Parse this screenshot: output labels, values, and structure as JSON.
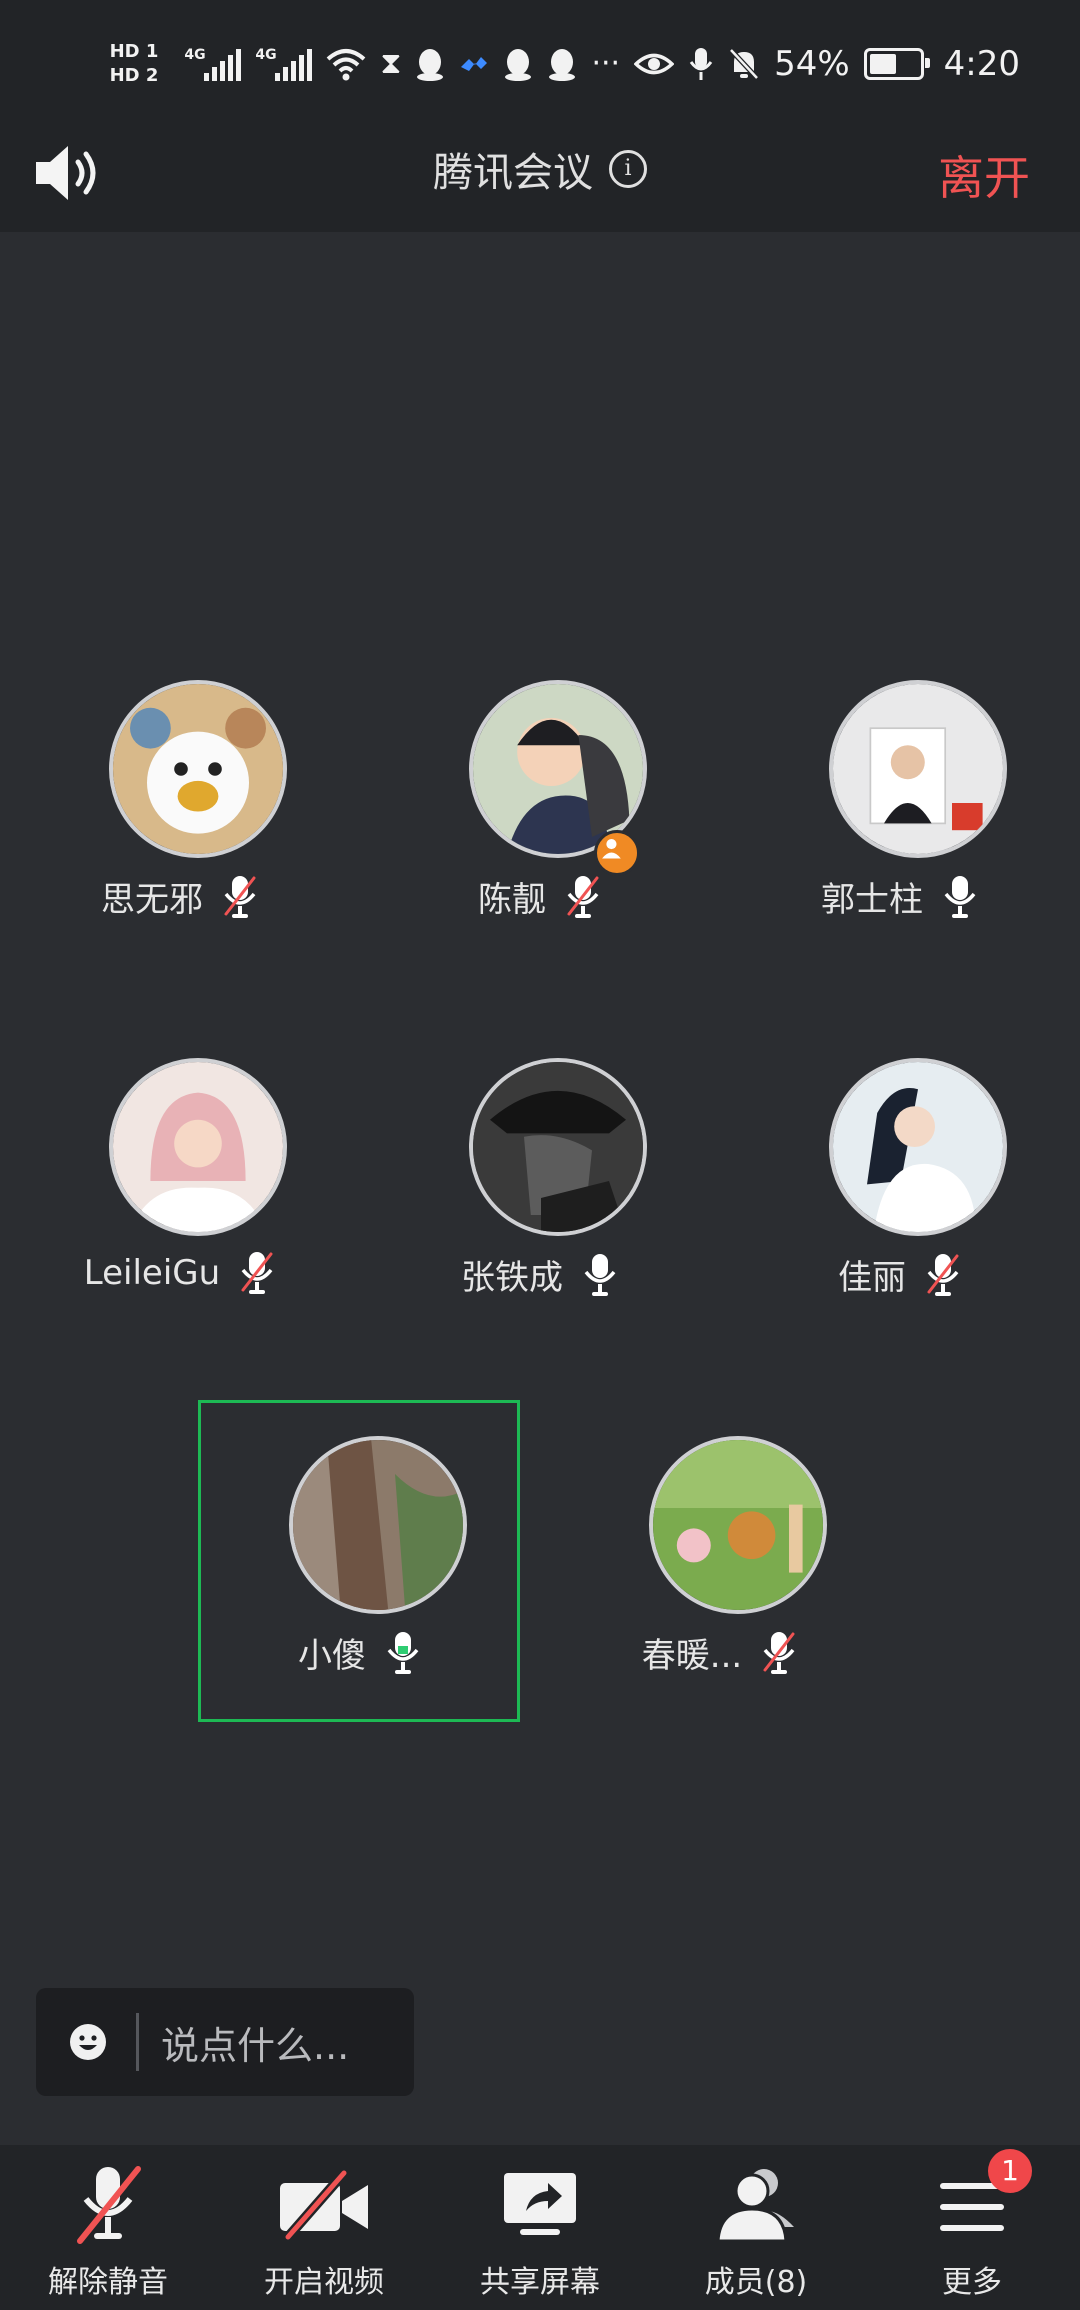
{
  "status_bar": {
    "hd1": "HD 1",
    "hd2": "HD 2",
    "net1": "4G",
    "net2": "4G",
    "more": "···",
    "battery_text": "54%",
    "battery_level": 0.54,
    "time": "4:20"
  },
  "header": {
    "title": "腾讯会议",
    "leave_label": "离开"
  },
  "participants": [
    {
      "name": "思无邪",
      "mic": "muted"
    },
    {
      "name": "陈靓",
      "mic": "muted",
      "host": true
    },
    {
      "name": "郭士柱",
      "mic": "on"
    },
    {
      "name": "LeileiGu",
      "mic": "muted"
    },
    {
      "name": "张铁成",
      "mic": "on"
    },
    {
      "name": "佳丽",
      "mic": "muted"
    },
    {
      "name": "小傻",
      "mic": "speaking",
      "active": true
    },
    {
      "name": "春暖...",
      "mic": "muted"
    }
  ],
  "chat": {
    "placeholder": "说点什么..."
  },
  "toolbar": {
    "unmute_label": "解除静音",
    "video_label": "开启视频",
    "share_label": "共享屏幕",
    "members_label": "成员(8)",
    "more_label": "更多",
    "more_badge": "1"
  },
  "colors": {
    "background": "#2b2d31",
    "bar": "#222427",
    "leave": "#f05353",
    "active_border": "#1db954",
    "muted_slash": "#f05353",
    "badge": "#f0474a",
    "host_badge": "#f08a24"
  }
}
